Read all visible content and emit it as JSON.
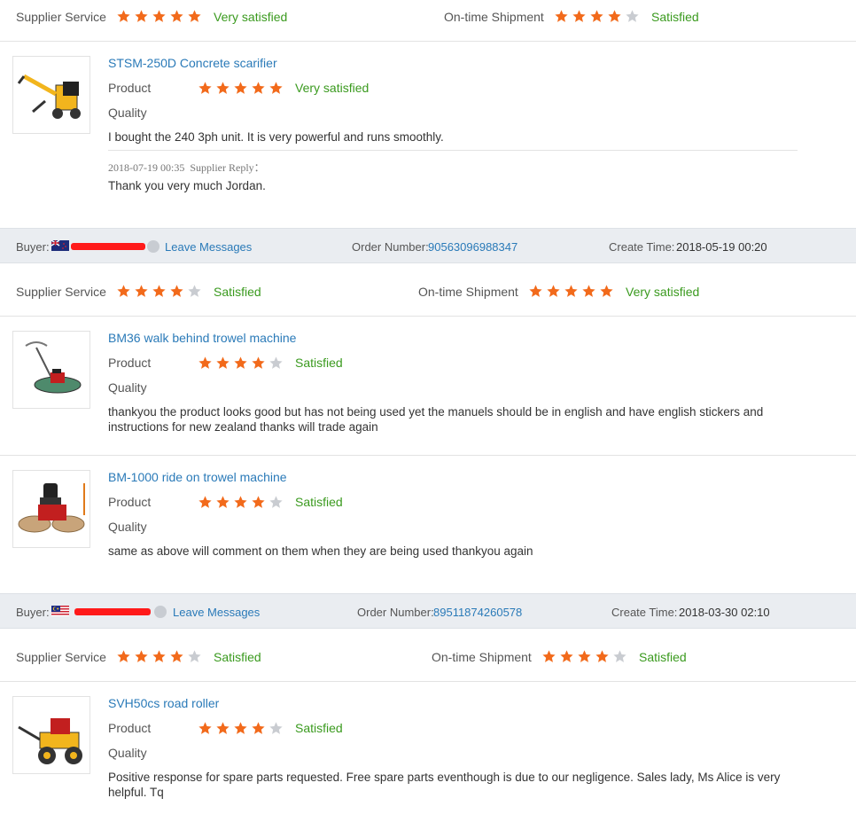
{
  "colors": {
    "star_on": "#f26a1b",
    "star_off": "#c9ccd1",
    "link": "#2a7ab8",
    "satisfied": "#3a9a1e",
    "buyer_bar": "#eaedf1"
  },
  "labels": {
    "supplier_service": "Supplier Service",
    "ontime_shipment": "On-time Shipment",
    "product": "Product",
    "quality": "Quality",
    "buyer": "Buyer:",
    "leave_messages": "Leave Messages",
    "order_number": "Order Number:",
    "create_time": "Create Time:",
    "supplier_reply": "Supplier Reply："
  },
  "reviews": [
    {
      "supplier_service": {
        "stars": 5,
        "text": "Very satisfied"
      },
      "ontime_shipment": {
        "stars": 4,
        "text": "Satisfied"
      },
      "items": [
        {
          "title": "STSM-250D Concrete scarifier",
          "icon": "scarifier-image",
          "product_stars": 5,
          "product_text": "Very satisfied",
          "comment": "I bought the 240 3ph unit. It is very powerful and runs smoothly.",
          "reply_time": "2018-07-19 00:35",
          "reply": "Thank you very much Jordan."
        }
      ]
    },
    {
      "buyer_flag": "new-zealand-flag",
      "order_number": "90563096988347",
      "create_time": "2018-05-19 00:20",
      "supplier_service": {
        "stars": 4,
        "text": "Satisfied"
      },
      "ontime_shipment": {
        "stars": 5,
        "text": "Very satisfied"
      },
      "items": [
        {
          "title": "BM36 walk behind trowel machine",
          "icon": "walk-behind-trowel-image",
          "product_stars": 4,
          "product_text": "Satisfied",
          "comment": "thankyou the product looks good but has not being used yet the manuels should be in english and have english stickers and instructions for new zealand thanks will trade again"
        },
        {
          "title": "BM-1000 ride on trowel machine",
          "icon": "ride-on-trowel-image",
          "product_stars": 4,
          "product_text": "Satisfied",
          "comment": "same as above will comment on them when they are being used thankyou again"
        }
      ]
    },
    {
      "buyer_flag": "malaysia-flag",
      "order_number": "89511874260578",
      "create_time": "2018-03-30 02:10",
      "supplier_service": {
        "stars": 4,
        "text": "Satisfied"
      },
      "ontime_shipment": {
        "stars": 4,
        "text": "Satisfied"
      },
      "items": [
        {
          "title": "SVH50cs road roller",
          "icon": "road-roller-image",
          "product_stars": 4,
          "product_text": "Satisfied",
          "comment": "Positive response for spare parts requested. Free spare parts eventhough is due to our negligence. Sales lady, Ms Alice is very helpful. Tq"
        }
      ]
    }
  ]
}
